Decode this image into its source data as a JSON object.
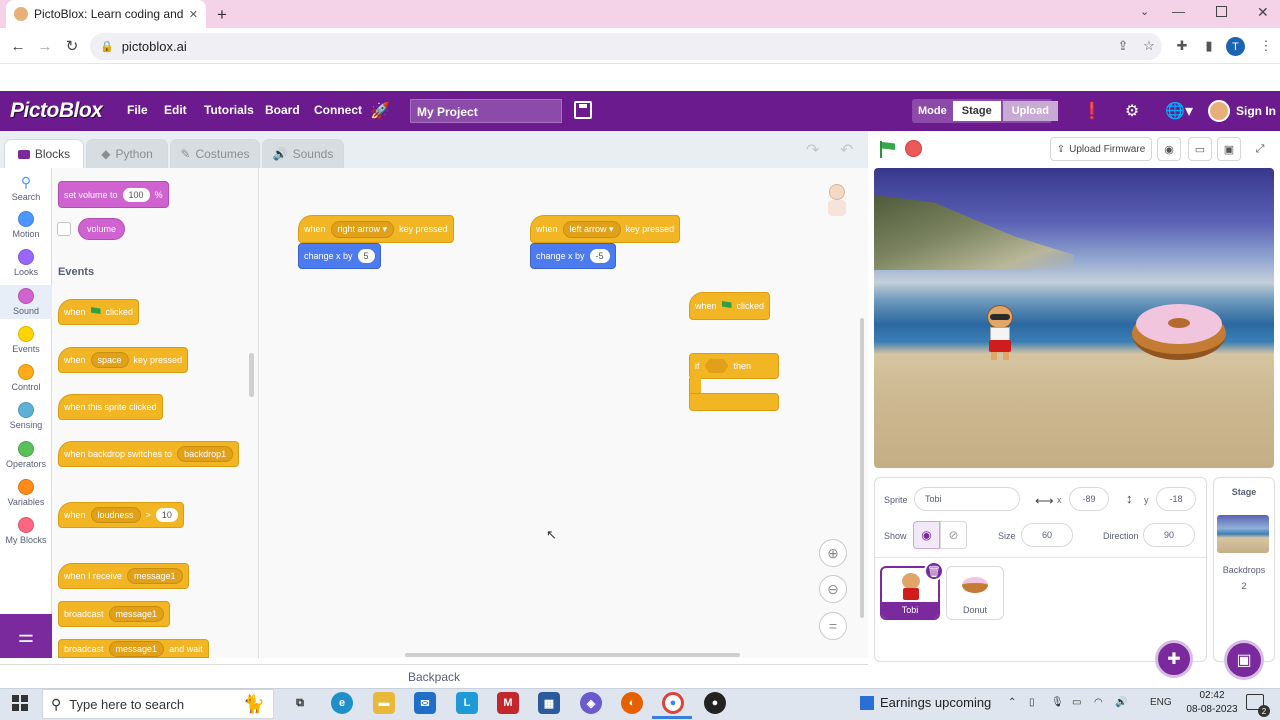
{
  "browser": {
    "tab_title": "PictoBlox: Learn coding and prog",
    "url": "pictoblox.ai",
    "profile_initial": "T"
  },
  "app": {
    "logo": "PictoBlox",
    "menu": [
      "File",
      "Edit",
      "Tutorials",
      "Board",
      "Connect"
    ],
    "project_name": "My Project",
    "mode_label": "Mode",
    "mode_stage": "Stage",
    "mode_upload": "Upload",
    "sign_in": "Sign In"
  },
  "editor_tabs": [
    "Blocks",
    "Python",
    "Costumes",
    "Sounds"
  ],
  "categories": [
    {
      "label": "Search",
      "color": "#4c97ff"
    },
    {
      "label": "Motion",
      "color": "#4c97ff"
    },
    {
      "label": "Looks",
      "color": "#9966ff"
    },
    {
      "label": "Sound",
      "color": "#cf63cf"
    },
    {
      "label": "Events",
      "color": "#ffd500"
    },
    {
      "label": "Control",
      "color": "#ffab19"
    },
    {
      "label": "Sensing",
      "color": "#5cb1d6"
    },
    {
      "label": "Operators",
      "color": "#59c059"
    },
    {
      "label": "Variables",
      "color": "#ff8c1a"
    },
    {
      "label": "My Blocks",
      "color": "#ff6680"
    }
  ],
  "palette": {
    "set_volume": "set volume to",
    "volume_value": "100",
    "percent": "%",
    "volume": "volume",
    "events_heading": "Events",
    "when": "when",
    "clicked": "clicked",
    "space": "space",
    "key_pressed": "key pressed",
    "when_sprite_clicked": "when this sprite clicked",
    "when_backdrop": "when backdrop switches to",
    "backdrop1": "backdrop1",
    "loudness": "loudness",
    "gt": ">",
    "loud_value": "10",
    "when_receive": "when I receive",
    "message1": "message1",
    "broadcast": "broadcast",
    "and_wait": "and wait"
  },
  "workspace": {
    "when": "when",
    "right_arrow": "right arrow",
    "left_arrow": "left arrow",
    "key_pressed": "key pressed",
    "change_x_by": "change x by",
    "val_right": "5",
    "val_left": "-5",
    "clicked": "clicked",
    "if": "if",
    "then": "then",
    "backpack": "Backpack"
  },
  "stage_toolbar": {
    "upload_firmware": "Upload Firmware"
  },
  "sprite_info": {
    "sprite_label": "Sprite",
    "sprite_name": "Tobi",
    "x_label": "x",
    "x": "-89",
    "y_label": "y",
    "y": "-18",
    "show_label": "Show",
    "size_label": "Size",
    "size": "60",
    "direction_label": "Direction",
    "direction": "90"
  },
  "sprites": [
    "Tobi",
    "Donut"
  ],
  "stage_panel": {
    "title": "Stage",
    "backdrops_label": "Backdrops",
    "backdrops_count": "2"
  },
  "taskbar": {
    "search_placeholder": "Type here to search",
    "news": "Earnings upcoming",
    "lang": "ENG",
    "time": "02:42",
    "date": "08-08-2023",
    "notif_count": "2"
  }
}
